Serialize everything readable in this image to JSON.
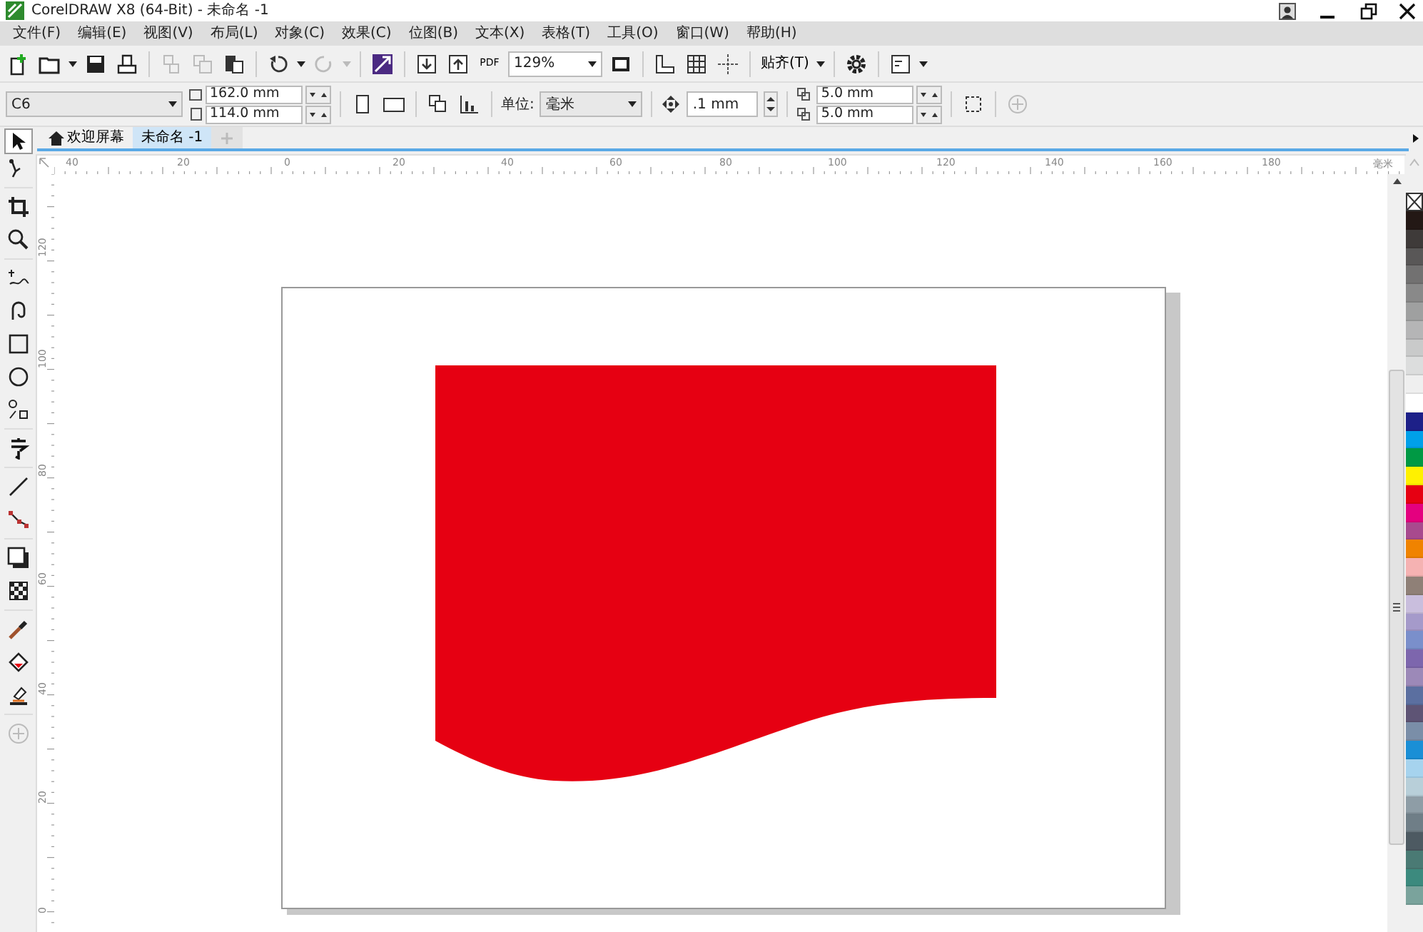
{
  "title_bar": {
    "title": "CorelDRAW X8 (64-Bit) - 未命名 -1"
  },
  "menu": [
    "文件(F)",
    "编辑(E)",
    "视图(V)",
    "布局(L)",
    "对象(C)",
    "效果(C)",
    "位图(B)",
    "文本(X)",
    "表格(T)",
    "工具(O)",
    "窗口(W)",
    "帮助(H)"
  ],
  "standard_toolbar": {
    "pdf_label": "PDF",
    "zoom": "129%",
    "snap": "贴齐(T)"
  },
  "property_bar": {
    "preset": "C6",
    "width": "162.0 mm",
    "height": "114.0 mm",
    "units_label": "单位:",
    "units": "毫米",
    "nudge": ".1 mm",
    "duplicate_x": "5.0 mm",
    "duplicate_y": "5.0 mm"
  },
  "tabs": [
    {
      "label": "欢迎屏幕",
      "selected": false
    },
    {
      "label": "未命名 -1",
      "selected": true
    }
  ],
  "rulers": {
    "horizontal": [
      "40",
      "20",
      "0",
      "20",
      "40",
      "60",
      "80",
      "100",
      "120",
      "140",
      "160",
      "180"
    ],
    "unit": "毫米",
    "vertical": [
      "120",
      "100",
      "80",
      "60",
      "40",
      "20",
      "0"
    ]
  },
  "palette": [
    {
      "color": "#231815"
    },
    {
      "color": "#3e3a39"
    },
    {
      "color": "#595757"
    },
    {
      "color": "#727171"
    },
    {
      "color": "#898989"
    },
    {
      "color": "#9fa0a0"
    },
    {
      "color": "#b5b5b6"
    },
    {
      "color": "#c9caca"
    },
    {
      "color": "#dcdddd"
    },
    {
      "color": "#efefef"
    },
    {
      "color": "#ffffff"
    },
    {
      "color": "#1d2088"
    },
    {
      "color": "#00a0e9"
    },
    {
      "color": "#009944"
    },
    {
      "color": "#fff100"
    },
    {
      "color": "#e60012"
    },
    {
      "color": "#e4007f"
    },
    {
      "color": "#a84a8e"
    },
    {
      "color": "#f08300"
    },
    {
      "color": "#f5b2b2"
    },
    {
      "color": "#8f8077"
    },
    {
      "color": "#c9bedd"
    },
    {
      "color": "#a59aca"
    },
    {
      "color": "#7a8fcb"
    },
    {
      "color": "#7d66ad"
    },
    {
      "color": "#9c89b8"
    },
    {
      "color": "#5b6fa0"
    },
    {
      "color": "#5e5475"
    },
    {
      "color": "#7a8ea8"
    },
    {
      "color": "#1a8fd6"
    },
    {
      "color": "#a6d3ee"
    },
    {
      "color": "#b8cfd9"
    },
    {
      "color": "#8e9da6"
    },
    {
      "color": "#6f7e87"
    },
    {
      "color": "#4d5a62"
    },
    {
      "color": "#4a7a74"
    },
    {
      "color": "#3c8a7e"
    },
    {
      "color": "#7aa39c"
    }
  ]
}
